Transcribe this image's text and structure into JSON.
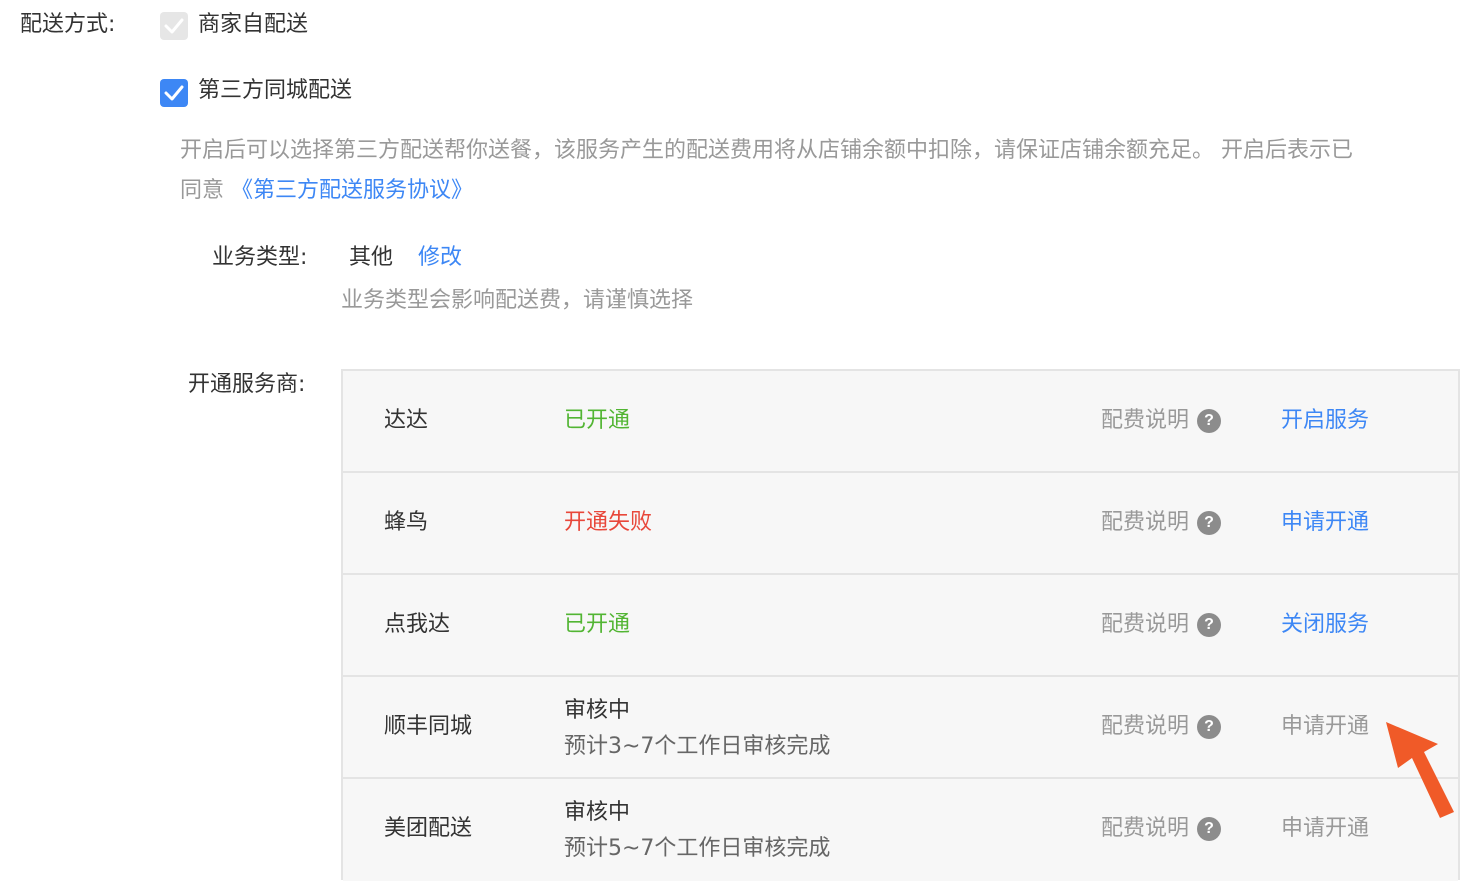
{
  "delivery": {
    "label": "配送方式:",
    "options": [
      {
        "label": "商家自配送",
        "checked": true,
        "disabled": true
      },
      {
        "label": "第三方同城配送",
        "checked": true,
        "disabled": false
      }
    ],
    "description_line1": "开启后可以选择第三方配送帮你送餐，该服务产生的配送费用将从店铺余额中扣除，请保证店铺余额充足。 开启后表示已",
    "description_line2_prefix": "同意 ",
    "agreement_link": "《第三方配送服务协议》"
  },
  "business_type": {
    "label": "业务类型:",
    "value": "其他",
    "edit_label": "修改",
    "hint": "业务类型会影响配送费，请谨慎选择"
  },
  "providers": {
    "label": "开通服务商:",
    "fee_label": "配费说明",
    "help_icon": "question-circle-icon",
    "rows": [
      {
        "name": "达达",
        "status": "已开通",
        "status_type": "ok",
        "action": "开启服务",
        "action_enabled": true
      },
      {
        "name": "蜂鸟",
        "status": "开通失败",
        "status_type": "fail",
        "action": "申请开通",
        "action_enabled": true
      },
      {
        "name": "点我达",
        "status": "已开通",
        "status_type": "ok",
        "action": "关闭服务",
        "action_enabled": true
      },
      {
        "name": "顺丰同城",
        "status": "审核中",
        "status_sub": "预计3~7个工作日审核完成",
        "status_type": "pending",
        "action": "申请开通",
        "action_enabled": false
      },
      {
        "name": "美团配送",
        "status": "审核中",
        "status_sub": "预计5~7个工作日审核完成",
        "status_type": "pending",
        "action": "申请开通",
        "action_enabled": false
      }
    ]
  },
  "colors": {
    "accent": "#3d87f5",
    "success": "#52b533",
    "danger": "#e8473a",
    "annotation_arrow": "#f05a28"
  }
}
